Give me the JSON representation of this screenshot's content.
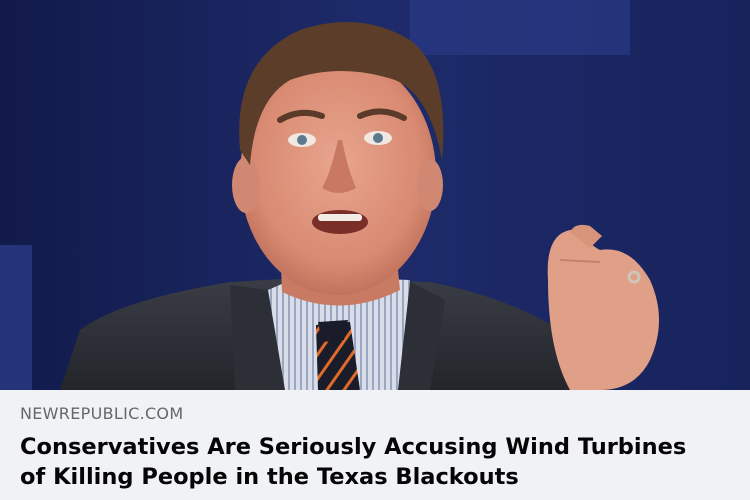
{
  "link_preview": {
    "domain": "NEWREPUBLIC.COM",
    "headline_line1": "Conservatives Are Seriously Accusing Wind Turbines",
    "headline_line2": "of Killing People in the Texas Blackouts"
  },
  "colors": {
    "backdrop": "#1b2660",
    "meta_background": "#f0f2f5",
    "domain_text": "#65676b",
    "headline_text": "#050505"
  }
}
